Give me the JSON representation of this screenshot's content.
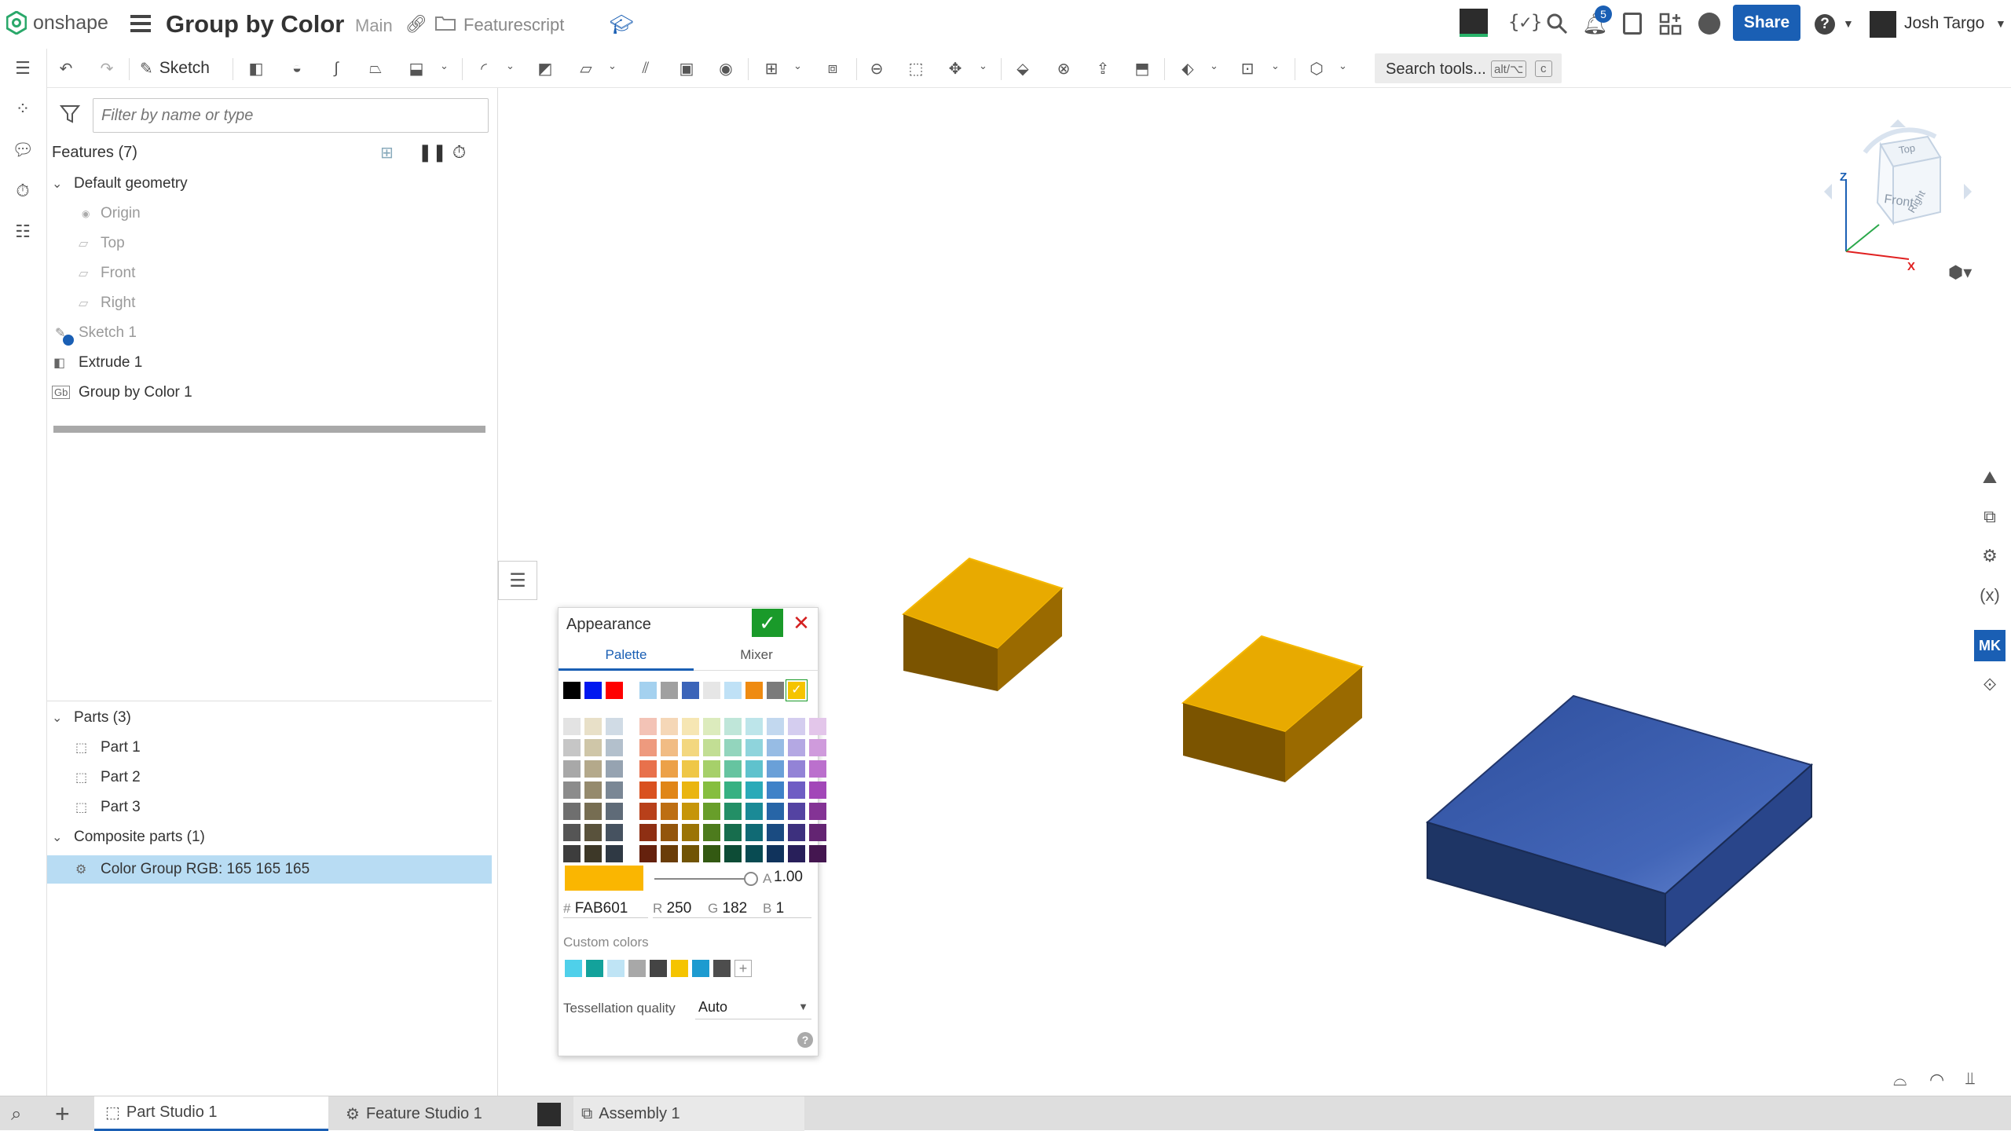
{
  "app": {
    "logo_text": "onshape",
    "document_title": "Group by Color",
    "branch": "Main",
    "folder": "Featurescript",
    "notification_count": "5",
    "share_label": "Share",
    "user_name": "Josh Targo"
  },
  "toolbar": {
    "sketch_label": "Sketch",
    "search_placeholder": "Search tools...",
    "search_shortcut_1": "alt/⌥",
    "search_shortcut_2": "c"
  },
  "panel": {
    "filter_placeholder": "Filter by name or type",
    "features_header": "Features (7)",
    "default_geometry": "Default geometry",
    "origin": "Origin",
    "top": "Top",
    "front": "Front",
    "right": "Right",
    "sketch1": "Sketch 1",
    "extrude1": "Extrude 1",
    "groupbycolor_icon": "Gb",
    "groupbycolor1": "Group by Color 1",
    "parts_header": "Parts (3)",
    "parts": [
      "Part 1",
      "Part 2",
      "Part 3"
    ],
    "composite_header": "Composite parts (1)",
    "composite_item": "Color Group RGB: 165 165 165"
  },
  "appearance": {
    "title": "Appearance",
    "tab_palette": "Palette",
    "tab_mixer": "Mixer",
    "current_color": "#FAB601",
    "alpha_label": "A",
    "alpha_value": "1.00",
    "hex_label": "#",
    "hex_value": "FAB601",
    "r_label": "R",
    "r_value": "250",
    "g_label": "G",
    "g_value": "182",
    "b_label": "B",
    "b_value": "1",
    "custom_colors_label": "Custom colors",
    "custom_colors": [
      "#4fd0ea",
      "#13a29b",
      "#bfe4f5",
      "#a8a8a8",
      "#444444",
      "#f5c400",
      "#1d9bd0",
      "#4d4d4d"
    ],
    "tessellation_label": "Tessellation quality",
    "tessellation_value": "Auto",
    "top_row_colors": [
      "#000000",
      "#0018f0",
      "#ff0000"
    ],
    "preset_row_colors": [
      "#a4d1ef",
      "#a0a0a0",
      "#3b64b9",
      "#e6e6e6",
      "#bfe1f6",
      "#ef8b11",
      "#7b7b7b",
      "#f5c400"
    ],
    "grey_columns": [
      [
        "#e3e3e3",
        "#c6c6c6",
        "#a8a8a8",
        "#8c8c8c",
        "#6f6f6f",
        "#555555",
        "#3d3d3d"
      ],
      [
        "#e8e0c8",
        "#cfc6a8",
        "#b4a98b",
        "#958a6d",
        "#766d52",
        "#59523c",
        "#3d3828"
      ],
      [
        "#d0dbe5",
        "#b3c0cc",
        "#96a3b1",
        "#7a8795",
        "#5f6b78",
        "#465260",
        "#2f3944"
      ]
    ],
    "hue_columns": [
      [
        "#f3c3b6",
        "#ee9a7e",
        "#e8714c",
        "#d9511f",
        "#b8401a",
        "#8e2f13",
        "#65210d"
      ],
      [
        "#f5d7b7",
        "#f1bc84",
        "#eca148",
        "#e08618",
        "#bd6e12",
        "#93550c",
        "#6a3d08"
      ],
      [
        "#f6e6b3",
        "#f3d77f",
        "#efc747",
        "#eab510",
        "#c69509",
        "#9b7406",
        "#715404"
      ],
      [
        "#dcebbd",
        "#c2de94",
        "#a6d06a",
        "#86be3f",
        "#689e2a",
        "#4d7b1d",
        "#335912"
      ],
      [
        "#bfe6d9",
        "#93d5bd",
        "#66c4a0",
        "#37b182",
        "#238f66",
        "#176d4d",
        "#0d4c36"
      ],
      [
        "#bde5ea",
        "#8fd4dc",
        "#5fc2cd",
        "#2aaab8",
        "#1a8a96",
        "#106a74",
        "#084b52"
      ],
      [
        "#c2d8ef",
        "#97bce4",
        "#6aa0d8",
        "#3f82c8",
        "#2765a7",
        "#1a4b81",
        "#10335c"
      ],
      [
        "#d4cdef",
        "#b4a8e3",
        "#9383d6",
        "#6f5dc4",
        "#5443a2",
        "#3d307e",
        "#281f5a"
      ],
      [
        "#e3c6ea",
        "#cf9bdc",
        "#bb70cd",
        "#a247b8",
        "#843395",
        "#632472",
        "#441650"
      ]
    ]
  }
}
